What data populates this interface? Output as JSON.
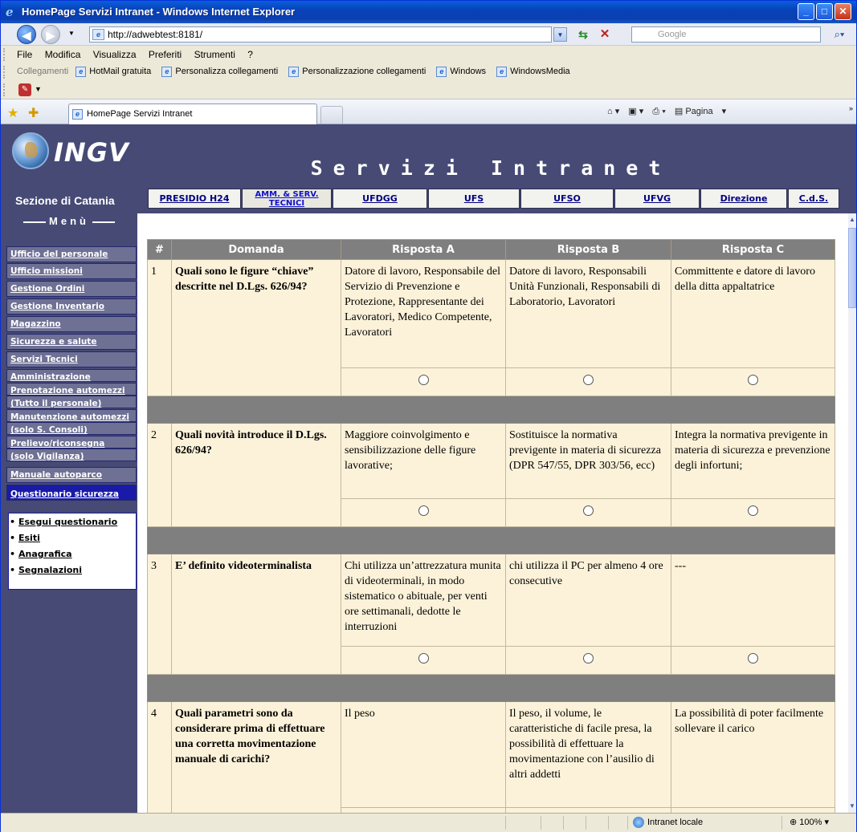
{
  "window": {
    "title": "HomePage Servizi Intranet - Windows Internet Explorer",
    "address": "http://adwebtest:8181/",
    "search_placeholder": "Google",
    "menu": [
      "File",
      "Modifica",
      "Visualizza",
      "Preferiti",
      "Strumenti",
      "?"
    ],
    "links_label": "Collegamenti",
    "links": [
      "HotMail gratuita",
      "Personalizza collegamenti",
      "Personalizzazione collegamenti",
      "Windows",
      "WindowsMedia"
    ],
    "tab_title": "HomePage Servizi Intranet",
    "page_menu": "Pagina",
    "status_zone": "Intranet locale",
    "zoom": "100%"
  },
  "site": {
    "logo": "INGV",
    "section": "Sezione di Catania",
    "banner_title": "Servizi Intranet",
    "menu_title": "Menù",
    "topnav": [
      "PRESIDIO H24",
      "AMM. & SERV. TECNICI",
      "UFDGG",
      "UFS",
      "UFSO",
      "UFVG",
      "Direzione",
      "C.d.S."
    ],
    "sidebar": [
      "Ufficio del personale",
      "Ufficio missioni",
      "Gestione Ordini",
      "Gestione Inventario",
      "Magazzino",
      "Sicurezza e salute",
      "Servizi Tecnici",
      "Amministrazione",
      "Prenotazione automezzi",
      "(Tutto il personale)",
      "Manutenzione automezzi",
      "(solo S. Consoli)",
      "Prelievo/riconsegna",
      "(solo Vigilanza)",
      "Manuale autoparco",
      "Questionario sicurezza"
    ],
    "submenu": [
      "Esegui questionario",
      "Esiti",
      "Anagrafica",
      "Segnalazioni"
    ]
  },
  "table": {
    "headers": [
      "#",
      "Domanda",
      "Risposta A",
      "Risposta B",
      "Risposta C"
    ],
    "rows": [
      {
        "n": "1",
        "q": "Quali sono le figure “chiave” descritte nel D.Lgs. 626/94?",
        "a": "Datore di lavoro, Responsabile del Servizio di Prevenzione e Protezione, Rappresentante dei Lavoratori, Medico Competente, Lavoratori",
        "b": "Datore di lavoro, Responsabili Unità Funzionali, Responsabili di Laboratorio, Lavoratori",
        "c": "Committente e datore di lavoro della ditta appaltatrice"
      },
      {
        "n": "2",
        "q": "Quali novità introduce il D.Lgs. 626/94?",
        "a": "Maggiore coinvolgimento e sensibilizzazione delle figure lavorative;",
        "b": "Sostituisce la normativa previgente in materia di sicurezza (DPR 547/55, DPR 303/56, ecc)",
        "c": "Integra la normativa previgente in materia di sicurezza e prevenzione degli infortuni;"
      },
      {
        "n": "3",
        "q": "E’ definito videoterminalista",
        "a": "Chi utilizza un’attrezzatura munita di videoterminali, in modo sistematico o abituale, per venti ore settimanali, dedotte le interruzioni",
        "b": "chi utilizza il PC per almeno 4 ore consecutive",
        "c": "---"
      },
      {
        "n": "4",
        "q": "Quali parametri sono da considerare prima di effettuare una corretta movimentazione manuale di carichi?",
        "a": "Il peso",
        "b": "Il peso, il volume, le caratteristiche di facile presa, la possibilità di effettuare la movimentazione con l’ausilio di altri addetti",
        "c": "La possibilità di poter facilmente sollevare il carico"
      }
    ]
  }
}
